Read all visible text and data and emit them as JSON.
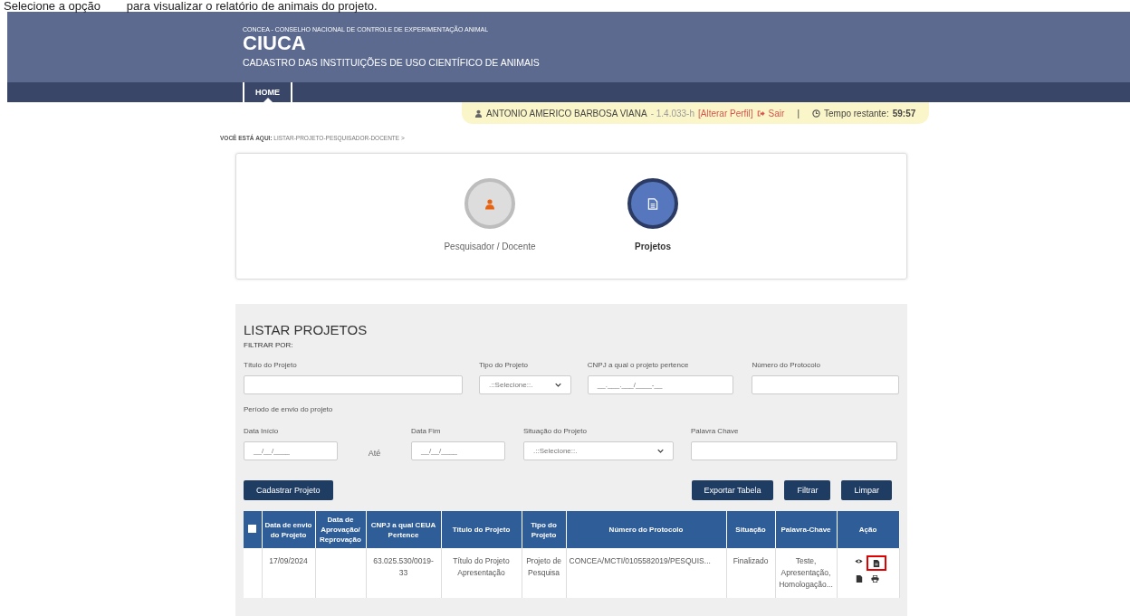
{
  "instruction": "Selecione a opção        para visualizar o relatório de animais do projeto.",
  "header": {
    "org": "CONCEA - CONSELHO NACIONAL DE CONTROLE DE EXPERIMENTAÇÃO ANIMAL",
    "logo": "CIUCA",
    "subtitle": "CADASTRO DAS INSTITUIÇÕES DE USO CIENTÍFICO DE ANIMAIS"
  },
  "nav": [
    {
      "label": "HOME",
      "selected": true
    }
  ],
  "user_bar": {
    "name": "ANTONIO AMERICO BARBOSA VIANA",
    "version": "- 1.4.033-h",
    "change_profile": "[Alterar Perfil]",
    "logout": "Sair",
    "separator": "|",
    "timer_label": "Tempo restante:",
    "timer": "59:57"
  },
  "breadcrumb": {
    "label": "VOCÊ ESTÁ AQUI:",
    "path": "LISTAR-PROJETO-PESQUISADOR-DOCENTE >"
  },
  "steps": [
    {
      "label": "Pesquisador / Docente",
      "kind": "person",
      "selected": false
    },
    {
      "label": "Projetos",
      "kind": "document",
      "selected": true
    }
  ],
  "panel": {
    "title": "LISTAR PROJETOS",
    "filter_label": "FILTRAR POR:",
    "period_label": "Período de envio do projeto",
    "until": "Até",
    "fields_row1": [
      {
        "label": "Título do Projeto",
        "kind": "text"
      },
      {
        "label": "Tipo do Projeto",
        "kind": "select",
        "value": ".::Selecione::."
      },
      {
        "label": "CNPJ a qual o projeto pertence",
        "kind": "text",
        "value": "__.___.___/____-__"
      },
      {
        "label": "Número do Protocolo",
        "kind": "text"
      }
    ],
    "date_start": {
      "label": "Data Início",
      "value": "__/__/____"
    },
    "date_end": {
      "label": "Data Fim",
      "value": "__/__/____"
    },
    "fields_row2": [
      {
        "label": "Situação do Projeto",
        "kind": "select",
        "value": ".::Selecione::."
      },
      {
        "label": "Palavra Chave",
        "kind": "text"
      }
    ],
    "left_buttons": [
      "Cadastrar Projeto"
    ],
    "right_buttons": [
      "Exportar Tabela",
      "Filtrar",
      "Limpar"
    ]
  },
  "table": {
    "select_all": {
      "checked": false
    },
    "columns": [
      "Data de envio do Projeto",
      "Data de Aprovação/ Reprovação",
      "CNPJ a qual CEUA Pertence",
      "Título do Projeto",
      "Tipo do Projeto",
      "Número do Protocolo",
      "Situação",
      "Palavra-Chave",
      "Ação"
    ],
    "rows": [
      {
        "cells": [
          "17/09/2024",
          "",
          "63.025.530/0019-33",
          "Título do Projeto Apresentação",
          "Projeto de Pesquisa",
          "CONCEA/MCTI/0105582019/PESQUIS...",
          "Finalizado",
          "Teste, Apresentação, Homologação..."
        ],
        "actions": [
          {
            "kind": "view",
            "highlighted": false
          },
          {
            "kind": "report",
            "highlighted": true
          },
          {
            "kind": "document",
            "highlighted": false
          },
          {
            "kind": "print",
            "highlighted": false
          }
        ]
      }
    ]
  }
}
